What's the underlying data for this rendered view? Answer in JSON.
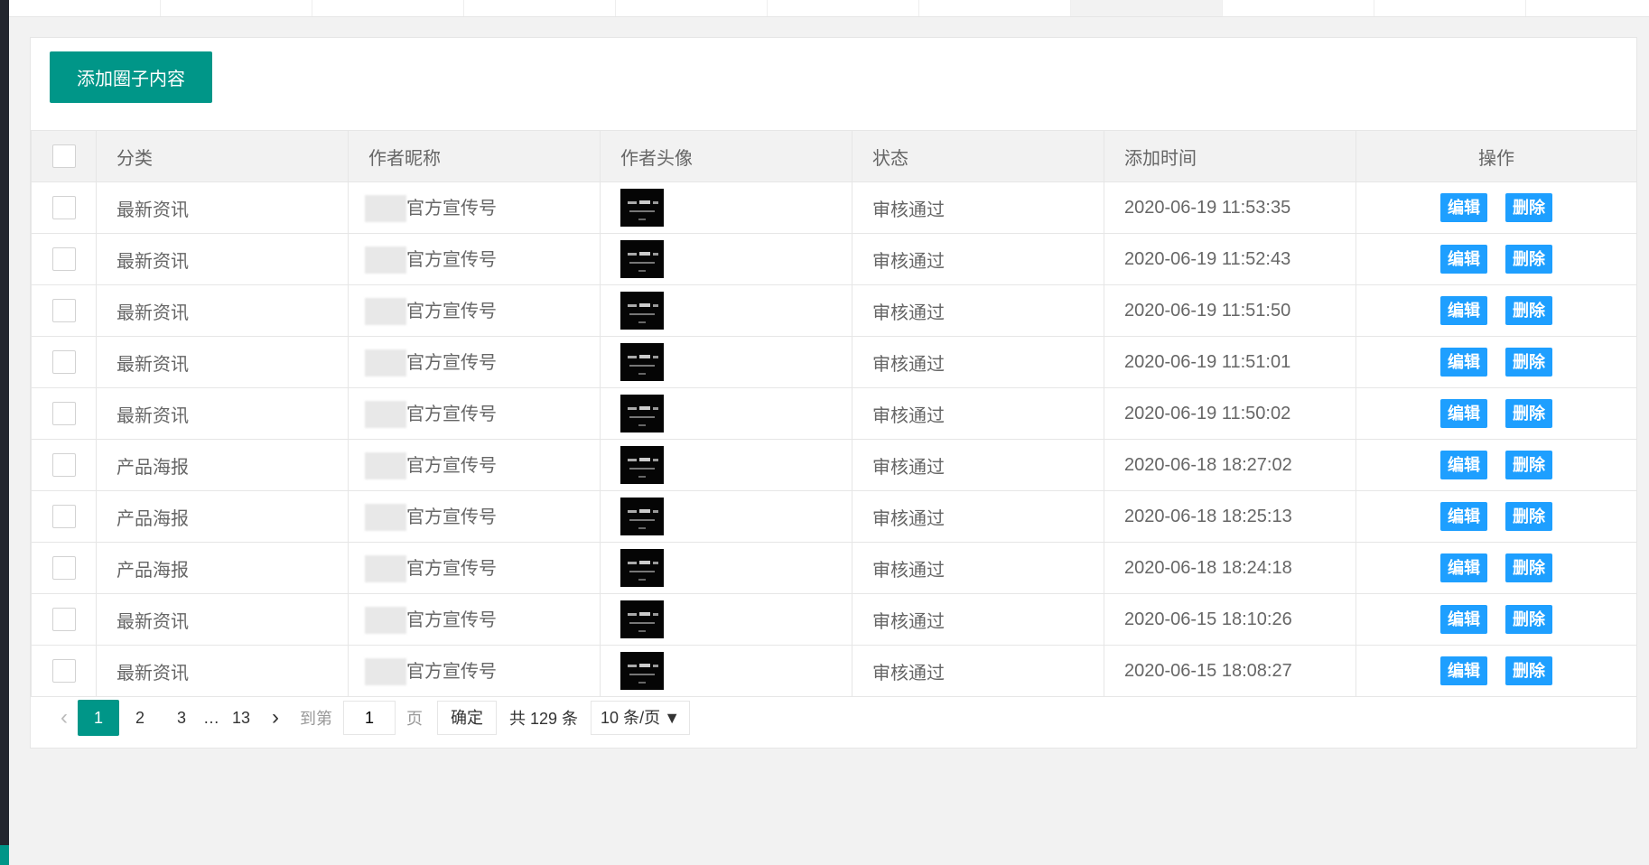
{
  "toolbar": {
    "add_label": "添加圈子内容"
  },
  "columns": [
    "分类",
    "作者昵称",
    "作者头像",
    "状态",
    "添加时间",
    "操作"
  ],
  "rows": [
    {
      "category": "最新资讯",
      "nickname": "官方宣传号",
      "status": "审核通过",
      "time": "2020-06-19 11:53:35"
    },
    {
      "category": "最新资讯",
      "nickname": "官方宣传号",
      "status": "审核通过",
      "time": "2020-06-19 11:52:43"
    },
    {
      "category": "最新资讯",
      "nickname": "官方宣传号",
      "status": "审核通过",
      "time": "2020-06-19 11:51:50"
    },
    {
      "category": "最新资讯",
      "nickname": "官方宣传号",
      "status": "审核通过",
      "time": "2020-06-19 11:51:01"
    },
    {
      "category": "最新资讯",
      "nickname": "官方宣传号",
      "status": "审核通过",
      "time": "2020-06-19 11:50:02"
    },
    {
      "category": "产品海报",
      "nickname": "官方宣传号",
      "status": "审核通过",
      "time": "2020-06-18 18:27:02"
    },
    {
      "category": "产品海报",
      "nickname": "官方宣传号",
      "status": "审核通过",
      "time": "2020-06-18 18:25:13"
    },
    {
      "category": "产品海报",
      "nickname": "官方宣传号",
      "status": "审核通过",
      "time": "2020-06-18 18:24:18"
    },
    {
      "category": "最新资讯",
      "nickname": "官方宣传号",
      "status": "审核通过",
      "time": "2020-06-15 18:10:26"
    },
    {
      "category": "最新资讯",
      "nickname": "官方宣传号",
      "status": "审核通过",
      "time": "2020-06-15 18:08:27"
    }
  ],
  "actions": {
    "edit": "编辑",
    "delete": "删除"
  },
  "pagination": {
    "pages": [
      "1",
      "2",
      "3"
    ],
    "ellipsis": "…",
    "last_page": "13",
    "goto_label": "到第",
    "goto_value": "1",
    "page_suffix": "页",
    "confirm_label": "确定",
    "total_label": "共 129 条",
    "page_size": "10 条/页",
    "current_page": 1
  },
  "colors": {
    "primary": "#009688",
    "action": "#1e9fff"
  },
  "icons": {
    "prev": "chevron-left-icon",
    "next": "chevron-right-icon",
    "dropdown": "caret-down-icon"
  }
}
